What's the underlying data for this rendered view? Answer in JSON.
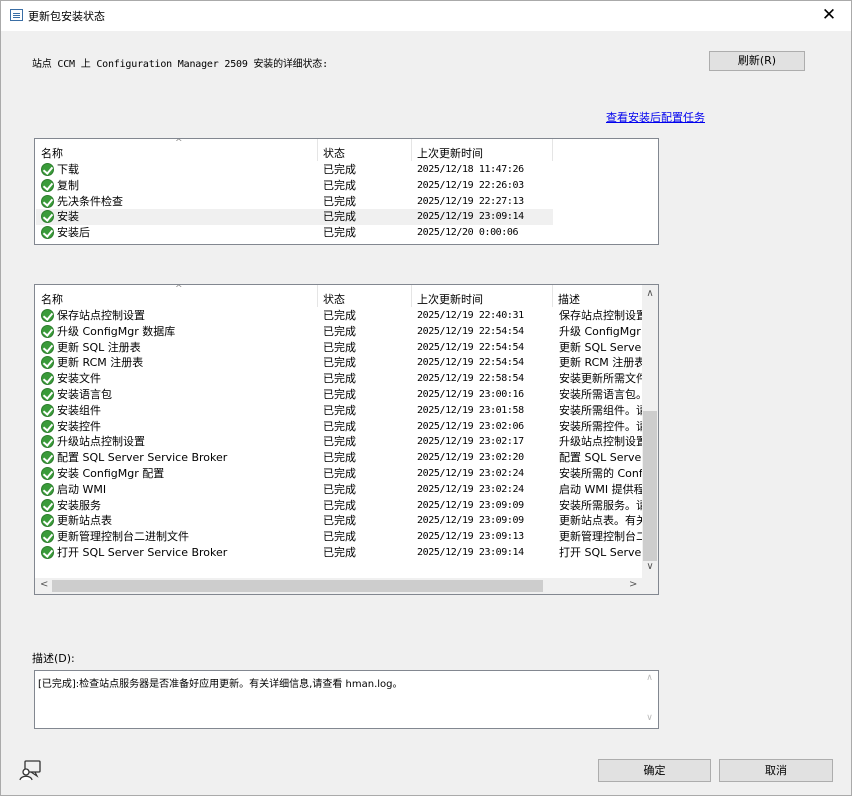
{
  "window": {
    "title": "更新包安装状态",
    "close_glyph": "✕"
  },
  "status_line": "站点 CCM 上 Configuration Manager 2509 安装的详细状态:",
  "refresh_label": "刷新(R)",
  "link_label": "查看安装后配置任务",
  "list1": {
    "headers": [
      "名称",
      "状态",
      "上次更新时间"
    ],
    "rows": [
      {
        "name": "下载",
        "status": "已完成",
        "time": "2025/12/18 11:47:26"
      },
      {
        "name": "复制",
        "status": "已完成",
        "time": "2025/12/19 22:26:03"
      },
      {
        "name": "先决条件检查",
        "status": "已完成",
        "time": "2025/12/19 22:27:13"
      },
      {
        "name": "安装",
        "status": "已完成",
        "time": "2025/12/19 23:09:14"
      },
      {
        "name": "安装后",
        "status": "已完成",
        "time": "2025/12/20 0:00:06"
      }
    ]
  },
  "list2": {
    "headers": [
      "名称",
      "状态",
      "上次更新时间",
      "描述"
    ],
    "rows": [
      {
        "name": "保存站点控制设置",
        "status": "已完成",
        "time": "2025/12/19 22:40:31",
        "desc": "保存站点控制设置"
      },
      {
        "name": "升级 ConfigMgr 数据库",
        "status": "已完成",
        "time": "2025/12/19 22:54:54",
        "desc": "升级 ConfigMgr"
      },
      {
        "name": "更新 SQL 注册表",
        "status": "已完成",
        "time": "2025/12/19 22:54:54",
        "desc": "更新 SQL Server"
      },
      {
        "name": "更新 RCM 注册表",
        "status": "已完成",
        "time": "2025/12/19 22:54:54",
        "desc": "更新 RCM 注册表"
      },
      {
        "name": "安装文件",
        "status": "已完成",
        "time": "2025/12/19 22:58:54",
        "desc": "安装更新所需文件"
      },
      {
        "name": "安装语言包",
        "status": "已完成",
        "time": "2025/12/19 23:00:16",
        "desc": "安装所需语言包。"
      },
      {
        "name": "安装组件",
        "status": "已完成",
        "time": "2025/12/19 23:01:58",
        "desc": "安装所需组件。请"
      },
      {
        "name": "安装控件",
        "status": "已完成",
        "time": "2025/12/19 23:02:06",
        "desc": "安装所需控件。请"
      },
      {
        "name": "升级站点控制设置",
        "status": "已完成",
        "time": "2025/12/19 23:02:17",
        "desc": "升级站点控制设置"
      },
      {
        "name": "配置 SQL Server Service Broker",
        "status": "已完成",
        "time": "2025/12/19 23:02:20",
        "desc": "配置 SQL Server"
      },
      {
        "name": "安装 ConfigMgr 配置",
        "status": "已完成",
        "time": "2025/12/19 23:02:24",
        "desc": "安装所需的 Confi"
      },
      {
        "name": "启动 WMI",
        "status": "已完成",
        "time": "2025/12/19 23:02:24",
        "desc": "启动 WMI 提供程"
      },
      {
        "name": "安装服务",
        "status": "已完成",
        "time": "2025/12/19 23:09:09",
        "desc": "安装所需服务。请"
      },
      {
        "name": "更新站点表",
        "status": "已完成",
        "time": "2025/12/19 23:09:09",
        "desc": "更新站点表。有关"
      },
      {
        "name": "更新管理控制台二进制文件",
        "status": "已完成",
        "time": "2025/12/19 23:09:13",
        "desc": "更新管理控制台二"
      },
      {
        "name": "打开 SQL Server Service Broker",
        "status": "已完成",
        "time": "2025/12/19 23:09:14",
        "desc": "打开 SQL Server"
      }
    ]
  },
  "description": {
    "label": "描述(D):",
    "text": "[已完成]:检查站点服务器是否准备好应用更新。有关详细信息,请查看 hman.log。"
  },
  "buttons": {
    "ok": "确定",
    "cancel": "取消"
  },
  "colors": {
    "check_green": "#3a9b3a",
    "link_blue": "#0000ee"
  }
}
